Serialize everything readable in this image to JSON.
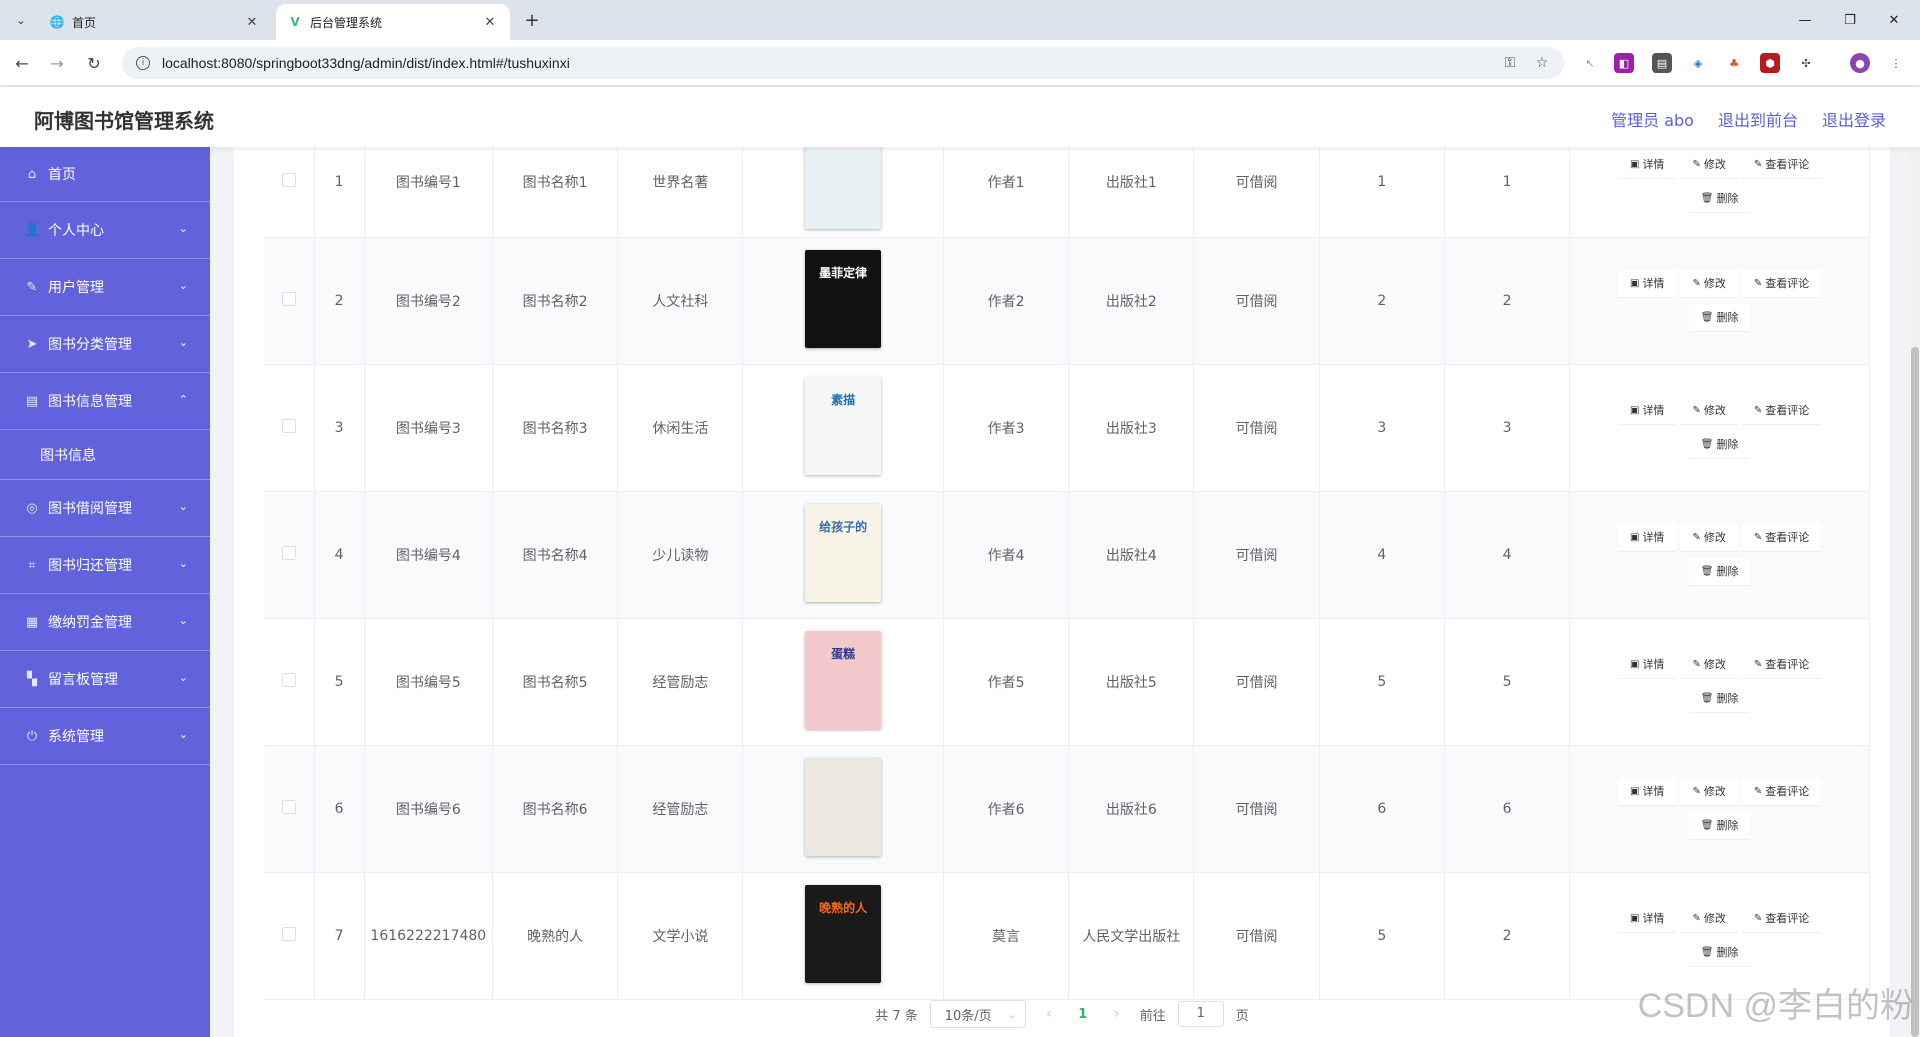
{
  "browser": {
    "tabs": [
      {
        "title": "首页",
        "active": false
      },
      {
        "title": "后台管理系统",
        "active": true
      }
    ],
    "url": "localhost:8080/springboot33dng/admin/dist/index.html#/tushuxinxi"
  },
  "header": {
    "title": "阿博图书馆管理系统",
    "links": [
      "管理员 abo",
      "退出到前台",
      "退出登录"
    ]
  },
  "sidebar": {
    "items": [
      {
        "label": "首页",
        "icon": "home-icon"
      },
      {
        "label": "个人中心",
        "icon": "user-icon"
      },
      {
        "label": "用户管理",
        "icon": "edit-icon"
      },
      {
        "label": "图书分类管理",
        "icon": "send-icon"
      },
      {
        "label": "图书信息管理",
        "icon": "list-icon"
      },
      {
        "label": "图书信息",
        "icon": ""
      },
      {
        "label": "图书借阅管理",
        "icon": "globe-icon"
      },
      {
        "label": "图书归还管理",
        "icon": "crop-icon"
      },
      {
        "label": "缴纳罚金管理",
        "icon": "document-icon"
      },
      {
        "label": "留言板管理",
        "icon": "grid-icon"
      },
      {
        "label": "系统管理",
        "icon": "power-icon"
      }
    ]
  },
  "table": {
    "rows": [
      {
        "idx": "1",
        "code": "图书编号1",
        "name": "图书名称1",
        "category": "世界名著",
        "author": "作者1",
        "publisher": "出版社1",
        "status": "可借阅",
        "c1": "1",
        "c2": "1",
        "cover_bg": "#e8f1f4",
        "cover_fg": "#4a90b8",
        "cover_text": ""
      },
      {
        "idx": "2",
        "code": "图书编号2",
        "name": "图书名称2",
        "category": "人文社科",
        "author": "作者2",
        "publisher": "出版社2",
        "status": "可借阅",
        "c1": "2",
        "c2": "2",
        "cover_bg": "#111111",
        "cover_fg": "#ffffff",
        "cover_text": "墨菲定律"
      },
      {
        "idx": "3",
        "code": "图书编号3",
        "name": "图书名称3",
        "category": "休闲生活",
        "author": "作者3",
        "publisher": "出版社3",
        "status": "可借阅",
        "c1": "3",
        "c2": "3",
        "cover_bg": "#f4f6f8",
        "cover_fg": "#1f6fb5",
        "cover_text": "素描"
      },
      {
        "idx": "4",
        "code": "图书编号4",
        "name": "图书名称4",
        "category": "少儿读物",
        "author": "作者4",
        "publisher": "出版社4",
        "status": "可借阅",
        "c1": "4",
        "c2": "4",
        "cover_bg": "#f7f3e6",
        "cover_fg": "#3a6ea5",
        "cover_text": "给孩子的"
      },
      {
        "idx": "5",
        "code": "图书编号5",
        "name": "图书名称5",
        "category": "经管励志",
        "author": "作者5",
        "publisher": "出版社5",
        "status": "可借阅",
        "c1": "5",
        "c2": "5",
        "cover_bg": "#f5c9cc",
        "cover_fg": "#2b3a8f",
        "cover_text": "蛋糕"
      },
      {
        "idx": "6",
        "code": "图书编号6",
        "name": "图书名称6",
        "category": "经管励志",
        "author": "作者6",
        "publisher": "出版社6",
        "status": "可借阅",
        "c1": "6",
        "c2": "6",
        "cover_bg": "#ece8e1",
        "cover_fg": "#5a4a3a",
        "cover_text": ""
      },
      {
        "idx": "7",
        "code": "1616222217480",
        "name": "晚熟的人",
        "category": "文学小说",
        "author": "莫言",
        "publisher": "人民文学出版社",
        "status": "可借阅",
        "c1": "5",
        "c2": "2",
        "cover_bg": "#1a1a1a",
        "cover_fg": "#f26a21",
        "cover_text": "晚熟的人"
      }
    ],
    "ops": {
      "detail": "详情",
      "edit": "修改",
      "comments": "查看评论",
      "delete": "删除"
    }
  },
  "pager": {
    "total": "共 7 条",
    "size": "10条/页",
    "current": "1",
    "goto_prefix": "前往",
    "goto_value": "1",
    "goto_suffix": "页"
  },
  "watermark": "CSDN @李白的粉",
  "colors": {
    "sidebar": "#6162dc",
    "accent_link": "#5b5fd6",
    "pager_active": "#31b16d"
  }
}
